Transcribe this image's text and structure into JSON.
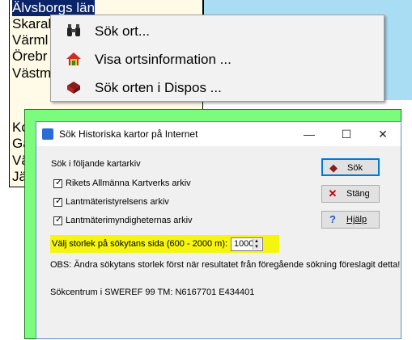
{
  "region_list": {
    "items": [
      "Älvsborgs län",
      "Skarab",
      "Värml",
      "Örebr",
      "Västm",
      "Ko",
      "Ga",
      "Vä",
      "Jä"
    ]
  },
  "context_menu": {
    "items": [
      {
        "label": "Sök ort...",
        "icon": "binoculars-icon"
      },
      {
        "label": "Visa ortsinformation ...",
        "icon": "house-icon"
      },
      {
        "label": "Sök orten i Dispos ...",
        "icon": "book-icon"
      }
    ]
  },
  "dialog": {
    "title": "Sök Historiska kartor på Internet",
    "minimize": "—",
    "maximize": "☐",
    "close": "✕",
    "section_label": "Sök i följande kartarkiv",
    "archives": [
      {
        "label": "Rikets Allmänna Kartverks arkiv",
        "checked": true
      },
      {
        "label": "Lantmäteristyrelsens arkiv",
        "checked": true
      },
      {
        "label": "Lantmäterimyndigheternas arkiv",
        "checked": true
      }
    ],
    "buttons": {
      "search": "Sök",
      "close": "Stäng",
      "help": "Hjälp"
    },
    "size_label": "Välj storlek på sökytans sida (600 - 2000 m):",
    "size_value": "1000",
    "obs_text": "OBS: Ändra sökytans storlek först när resultatet från föregående sökning föreslagit detta!",
    "center_text": "Sökcentrum i SWEREF 99 TM:  N6167701 E434401"
  },
  "colors": {
    "highlight": "#f5f50f",
    "frame": "#7cfc7c",
    "accent": "#0078d7"
  }
}
